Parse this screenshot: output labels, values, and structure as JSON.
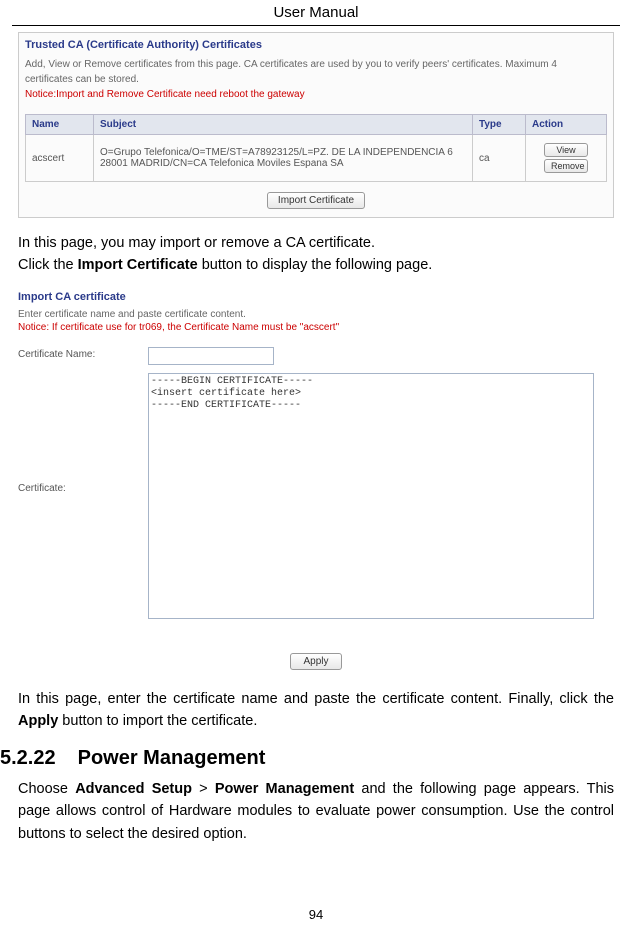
{
  "header": {
    "title": "User Manual"
  },
  "screenshot1": {
    "title": "Trusted CA (Certificate Authority) Certificates",
    "desc": "Add, View or Remove certificates from this page. CA certificates are used by you to verify peers' certificates. Maximum 4 certificates can be stored.",
    "notice": "Notice:Import and Remove Certificate need reboot the gateway",
    "table": {
      "headers": [
        "Name",
        "Subject",
        "Type",
        "Action"
      ],
      "row": {
        "name": "acscert",
        "subject": "O=Grupo Telefonica/O=TME/ST=A78923125/L=PZ. DE LA INDEPENDENCIA 6 28001 MADRID/CN=CA Telefonica Moviles Espana SA",
        "type": "ca",
        "view": "View",
        "remove": "Remove"
      }
    },
    "import_btn": "Import Certificate"
  },
  "para1_a": "In this page, you may import or remove a CA certificate.",
  "para1_b_pre": "Click the ",
  "para1_b_bold": "Import Certificate",
  "para1_b_post": " button to display the following page.",
  "screenshot2": {
    "title": "Import CA certificate",
    "desc": "Enter certificate name and paste certificate content.",
    "notice": "Notice: If certificate use for tr069, the Certificate Name must be \"acscert\"",
    "name_label": "Certificate Name:",
    "cert_label": "Certificate:",
    "cert_content": "-----BEGIN CERTIFICATE-----\n<insert certificate here>\n-----END CERTIFICATE-----",
    "apply_btn": "Apply"
  },
  "para2_pre": "In this page, enter the certificate name and paste the certificate content. Finally, click the ",
  "para2_bold": "Apply",
  "para2_post": " button to import the certificate.",
  "section": {
    "number": "5.2.22",
    "title": "Power Management"
  },
  "para3_pre": "Choose ",
  "para3_b1": "Advanced Setup",
  "para3_mid": " > ",
  "para3_b2": "Power Management",
  "para3_post": " and the following page appears. This page allows control of Hardware modules to evaluate power consumption. Use the control buttons to select the desired option.",
  "footer": {
    "page": "94"
  }
}
